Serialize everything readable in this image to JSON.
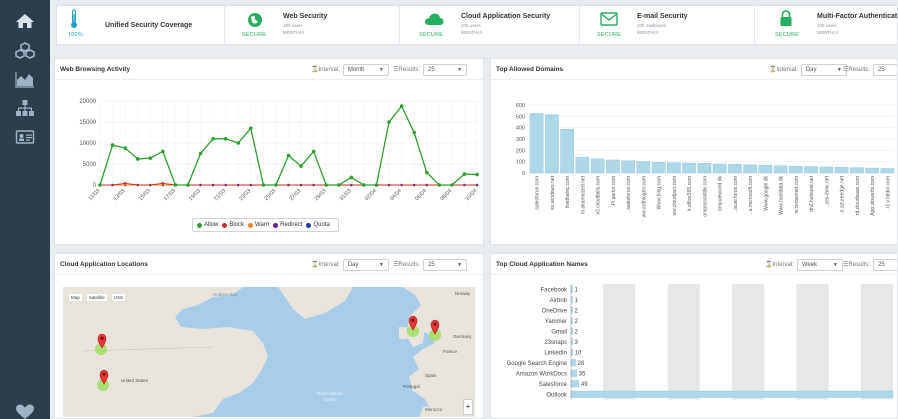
{
  "sidebar": {
    "items": [
      {
        "icon": "home-icon"
      },
      {
        "icon": "cubes-icon"
      },
      {
        "icon": "area-chart-icon"
      },
      {
        "icon": "sitemap-icon"
      },
      {
        "icon": "id-card-icon"
      }
    ],
    "bottom_icon": "heart-icon"
  },
  "status_strip": {
    "coverage": {
      "percent": "100%",
      "title": "Unified Security Coverage"
    },
    "items": [
      {
        "title": "Web Security",
        "line1": "100 users",
        "line2": "MONTHLY",
        "status": "SECURE",
        "icon": "globe-shield-icon"
      },
      {
        "title": "Cloud Application Security",
        "line1": "100 users",
        "line2": "MONTHLY",
        "status": "SECURE",
        "icon": "cloud-icon"
      },
      {
        "title": "E-mail Security",
        "line1": "100 mailboxes",
        "line2": "MONTHLY",
        "status": "SECURE",
        "icon": "envelope-icon"
      },
      {
        "title": "Multi-Factor Authenticat",
        "line1": "100 users",
        "line2": "MONTHLY",
        "status": "SECURE",
        "icon": "lock-icon"
      }
    ]
  },
  "controls": {
    "interval_label": "Interval:",
    "results_label": "Results:"
  },
  "panels": {
    "web_browsing": {
      "title": "Web Browsing Activity",
      "interval": "Month",
      "results": "25"
    },
    "top_domains": {
      "title": "Top Allowed Domains",
      "interval": "Day",
      "results": "25"
    },
    "cloud_locations": {
      "title": "Cloud Application Locations",
      "interval": "Day",
      "results": "25"
    },
    "cloud_names": {
      "title": "Top Cloud Application Names",
      "interval": "Week",
      "results": "25"
    }
  },
  "map": {
    "tabs": [
      "Map",
      "Satellite",
      "USS"
    ],
    "labels": {
      "hudson_bay": "Hudson Bay",
      "norway": "Norway",
      "germany": "Germany",
      "france": "France",
      "spain": "Spain",
      "portugal": "Portugal",
      "morocco": "Morocco",
      "us": "United States",
      "ocean": "North Atlantic Ocean",
      "zoom": "+"
    }
  },
  "chart_data": [
    {
      "type": "line",
      "title": "Web Browsing Activity",
      "x": [
        "11/03",
        "12/03",
        "13/03",
        "14/03",
        "15/03",
        "16/03",
        "17/03",
        "18/03",
        "19/03",
        "20/03",
        "21/03",
        "22/03",
        "23/03",
        "24/03",
        "25/03",
        "26/03",
        "27/03",
        "28/03",
        "29/03",
        "30/03",
        "31/03",
        "01/04",
        "02/04",
        "03/04",
        "04/04",
        "05/04",
        "06/04",
        "07/04",
        "08/04",
        "09/04",
        "10/04"
      ],
      "x_tick_labels": [
        "11/03",
        "13/03",
        "15/03",
        "17/03",
        "19/03",
        "21/03",
        "23/03",
        "25/03",
        "27/03",
        "29/03",
        "31/03",
        "02/04",
        "04/04",
        "06/04",
        "08/04",
        "10/04"
      ],
      "ylim": [
        0,
        20000
      ],
      "y_ticks": [
        "0",
        "5000",
        "10000",
        "15000",
        "20000"
      ],
      "grid": true,
      "legend": "bottom",
      "series": [
        {
          "name": "Allow",
          "color": "#2ca02c",
          "values": [
            0,
            9500,
            8800,
            6200,
            6400,
            8000,
            0,
            0,
            7500,
            11000,
            11000,
            10000,
            13500,
            0,
            0,
            7000,
            4500,
            8000,
            0,
            0,
            1800,
            0,
            0,
            15000,
            18800,
            12500,
            3000,
            0,
            0,
            2600,
            2500
          ]
        },
        {
          "name": "Block",
          "color": "#d62728",
          "values": [
            0,
            0,
            400,
            0,
            0,
            400,
            0,
            0,
            0,
            0,
            0,
            0,
            0,
            0,
            0,
            0,
            0,
            0,
            0,
            0,
            0,
            0,
            0,
            0,
            0,
            0,
            0,
            0,
            0,
            0,
            0
          ]
        },
        {
          "name": "Warn",
          "color": "#ff7f0e",
          "values": [
            0,
            0,
            0,
            0,
            0,
            0,
            0,
            0,
            0,
            0,
            0,
            0,
            0,
            0,
            0,
            0,
            0,
            0,
            0,
            0,
            0,
            0,
            0,
            0,
            0,
            0,
            0,
            0,
            0,
            0,
            0
          ]
        },
        {
          "name": "Redirect",
          "color": "#6a1b9a",
          "values": [
            0,
            0,
            0,
            0,
            0,
            0,
            0,
            0,
            0,
            0,
            0,
            0,
            0,
            0,
            0,
            0,
            0,
            0,
            0,
            0,
            0,
            0,
            0,
            0,
            0,
            0,
            0,
            0,
            0,
            0,
            0
          ]
        },
        {
          "name": "Quota",
          "color": "#1f3b9e",
          "values": [
            0,
            0,
            0,
            0,
            0,
            0,
            0,
            0,
            0,
            0,
            0,
            0,
            0,
            0,
            0,
            0,
            0,
            0,
            0,
            0,
            0,
            0,
            0,
            0,
            0,
            0,
            0,
            0,
            0,
            0,
            0
          ]
        }
      ]
    },
    {
      "type": "bar",
      "title": "Top Allowed Domains",
      "categories": [
        "..salesforce.com",
        "ss.windows.net",
        "livethatnc.com",
        "m.akamaized.net",
        "v2.cloudtalis.com",
        "Pi.parlor.com",
        "..salesforce.com",
        "ww.ardblogen.com",
        "Www.bing.com",
        "ww.cloudpun.com",
        "k.office365.com",
        "ompassostde.com",
        "ompuleworld.dk",
        "..isual.force.com",
        "..a.microsoft.com",
        "Www.google.dk",
        "Www.baeldata.dk",
        "w.censomet.com",
        "dn2.hubspot.net",
        "..ces-ibmc.net",
        "..e.azureedge.net",
        "rd.cloudsaas.com",
        "App.stowerbi.com",
        "..rz.v.faldor.com"
      ],
      "values": [
        525,
        515,
        385,
        140,
        125,
        115,
        108,
        102,
        95,
        92,
        88,
        85,
        80,
        78,
        72,
        68,
        64,
        60,
        57,
        54,
        50,
        47,
        44,
        40
      ],
      "color": "#aed8e8",
      "ylim": [
        0,
        600
      ],
      "y_ticks": [
        "0",
        "100",
        "200",
        "300",
        "400",
        "500",
        "600"
      ],
      "grid": true
    },
    {
      "type": "bar",
      "orientation": "horizontal",
      "title": "Top Cloud Application Names",
      "categories": [
        "Facebook",
        "Airbnb",
        "OneDrive",
        "Yammer",
        "Gmail",
        "23snaps",
        "LinkedIn",
        "Google Search Engine",
        "Amazon WorkDocs",
        "Salesforce",
        "Outlook"
      ],
      "values": [
        1,
        1,
        2,
        2,
        2,
        3,
        10,
        28,
        35,
        49,
        2000
      ],
      "value_labels": [
        "1",
        "1",
        "2",
        "2",
        "2",
        "3",
        "10",
        "28",
        "35",
        "49",
        ""
      ],
      "color": "#aed8e8"
    }
  ],
  "markers": {
    "pins": [
      "pin-icon",
      "pin-icon",
      "pin-icon",
      "pin-icon"
    ]
  }
}
